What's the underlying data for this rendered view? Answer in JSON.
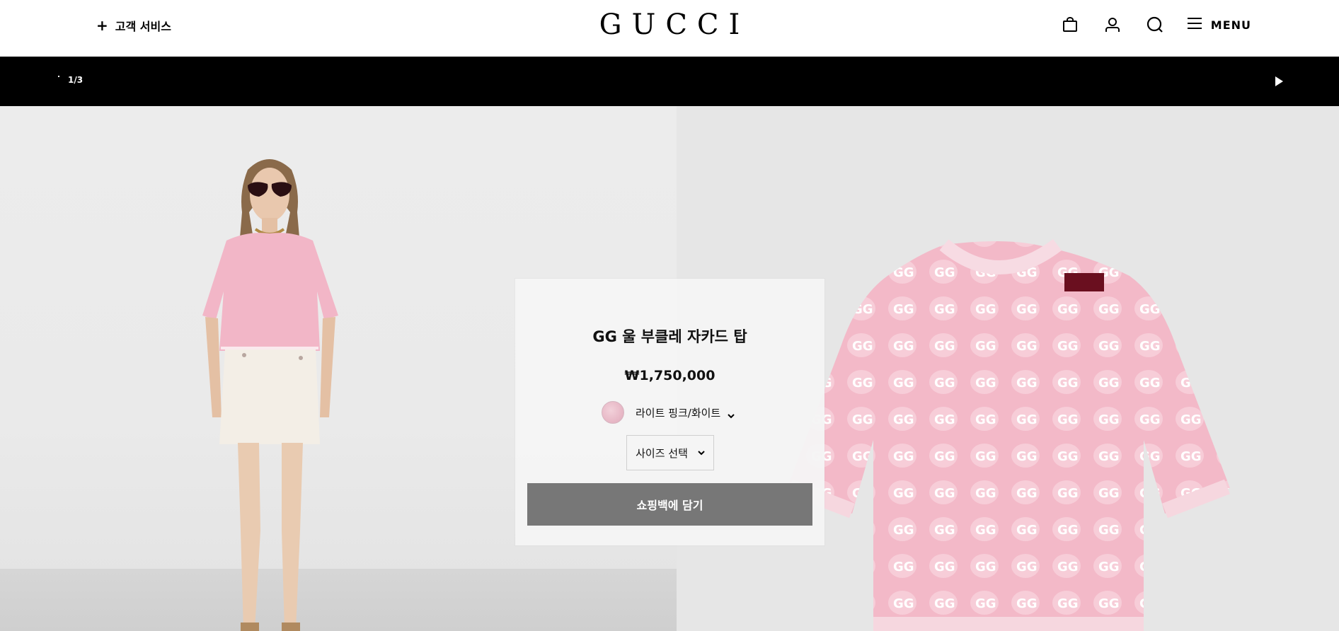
{
  "header": {
    "customer_service": "고객 서비스",
    "logo": "GUCCI",
    "menu_label": "MENU",
    "icons": [
      "shopping-bag-icon",
      "account-icon",
      "search-icon",
      "hamburger-menu-icon"
    ]
  },
  "carousel": {
    "counter": "1/3",
    "control": "play-icon"
  },
  "product": {
    "title": "GG 울 부클레 자카드 탑",
    "price": "₩1,750,000",
    "color": "라이트 핑크/화이트",
    "size_select": "사이즈 선택",
    "add_to_bag": "쇼핑백에 담기"
  },
  "colors": {
    "header_bg": "#ffffff",
    "carousel_bg": "#000000",
    "button_bg": "#777777",
    "top_pink": "#f2b6c7",
    "skirt_white": "#f3eee6"
  }
}
